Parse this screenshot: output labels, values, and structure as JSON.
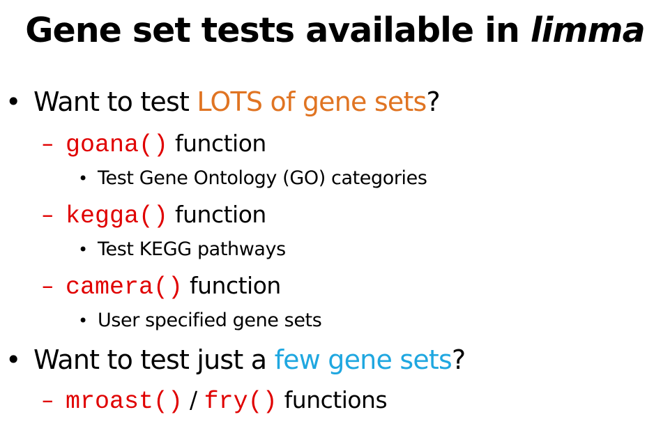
{
  "title": {
    "main": "Gene set tests available in ",
    "emphasis": "limma"
  },
  "bullets": [
    {
      "marker": "•",
      "prefix": "Want to test ",
      "highlight": "LOTS of gene sets",
      "suffix": "?",
      "highlight_color": "#e07422"
    },
    {
      "marker": "•",
      "prefix": "Want to test just a ",
      "highlight": "few gene sets",
      "suffix": "?",
      "highlight_color": "#1fa7e0"
    }
  ],
  "items": [
    {
      "dash": "–",
      "code": "goana()",
      "text": " function",
      "sub_marker": "•",
      "sub": "Test Gene Ontology (GO) categories"
    },
    {
      "dash": "–",
      "code": "kegga()",
      "text": " function",
      "sub_marker": "•",
      "sub": "Test KEGG pathways"
    },
    {
      "dash": "–",
      "code": "camera()",
      "text": " function",
      "sub_marker": "•",
      "sub": "User specified gene sets"
    }
  ],
  "last_item": {
    "dash": "–",
    "code1": "mroast()",
    "separator": " / ",
    "code2": "fry()",
    "text": " functions"
  },
  "colors": {
    "code": "#e00000",
    "orange": "#e07422",
    "blue": "#1fa7e0"
  }
}
